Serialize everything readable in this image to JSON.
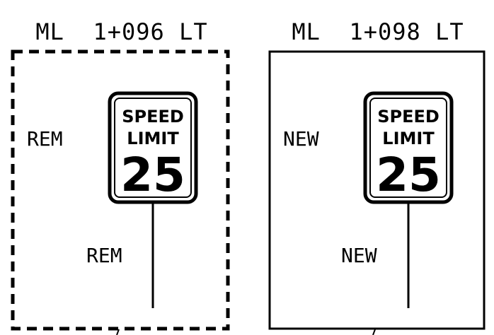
{
  "panels": [
    {
      "station": "ML  1+096 LT",
      "sign_callout": "REM",
      "post_callout": "REM",
      "sign": {
        "line1": "SPEED",
        "line2": "LIMIT",
        "number": "25"
      }
    },
    {
      "station": "ML  1+098 LT",
      "sign_callout": "NEW",
      "post_callout": "NEW",
      "sign": {
        "line1": "SPEED",
        "line2": "LIMIT",
        "number": "25"
      }
    }
  ],
  "colors": {
    "ink": "#000000",
    "background": "#ffffff"
  }
}
